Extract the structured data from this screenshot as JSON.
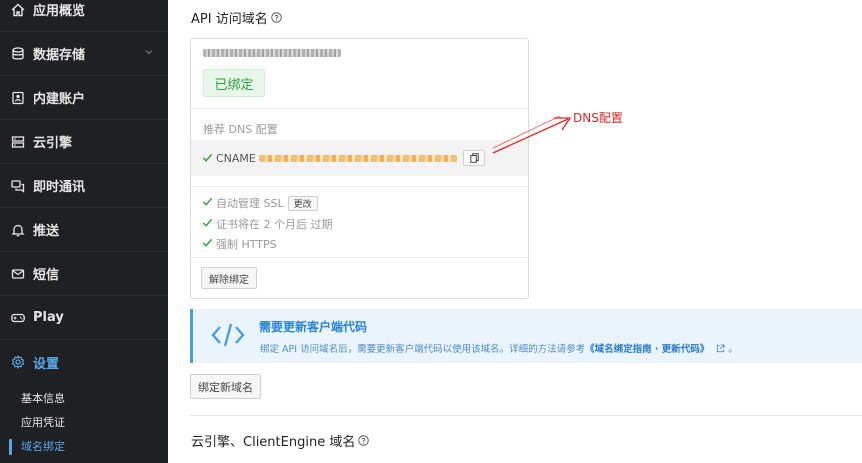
{
  "sidebar": {
    "items": [
      {
        "label": "应用概览",
        "icon": "home-icon"
      },
      {
        "label": "数据存储",
        "icon": "database-icon"
      },
      {
        "label": "内建账户",
        "icon": "id-card-icon"
      },
      {
        "label": "云引擎",
        "icon": "server-icon"
      },
      {
        "label": "即时通讯",
        "icon": "chat-icon"
      },
      {
        "label": "推送",
        "icon": "bell-icon"
      },
      {
        "label": "短信",
        "icon": "mail-icon"
      },
      {
        "label": "Play",
        "icon": "gamepad-icon"
      },
      {
        "label": "设置",
        "icon": "gear-icon"
      }
    ],
    "sub_items": [
      {
        "label": "基本信息"
      },
      {
        "label": "应用凭证"
      },
      {
        "label": "域名绑定"
      }
    ]
  },
  "main": {
    "api_section_title": "API 访问域名",
    "card": {
      "status_badge": "已绑定",
      "dns_heading": "推荐 DNS 配置",
      "cname_label": "CNAME",
      "features": [
        {
          "label": "自动管理 SSL",
          "button": "更改"
        },
        {
          "label": "证书将在 2 个月后 过期"
        },
        {
          "label": "强制 HTTPS"
        }
      ],
      "unbind_button": "解除绑定"
    },
    "annotation": "DNS配置",
    "notice": {
      "title": "需要更新客户端代码",
      "text": "绑定 API 访问域名后，需要更新客户端代码以使用该域名。详细的方法请参考",
      "link": "《域名绑定指南 · 更新代码》",
      "suffix": "。"
    },
    "bind_new_button": "绑定新域名",
    "engine_section_title": "云引擎、ClientEngine 域名"
  },
  "colors": {
    "sidebar_bg": "#1f2023",
    "accent": "#5aa7e6",
    "success": "#2e9e3f",
    "annotation": "#e02424",
    "notice_bg": "#eaf4fc"
  }
}
